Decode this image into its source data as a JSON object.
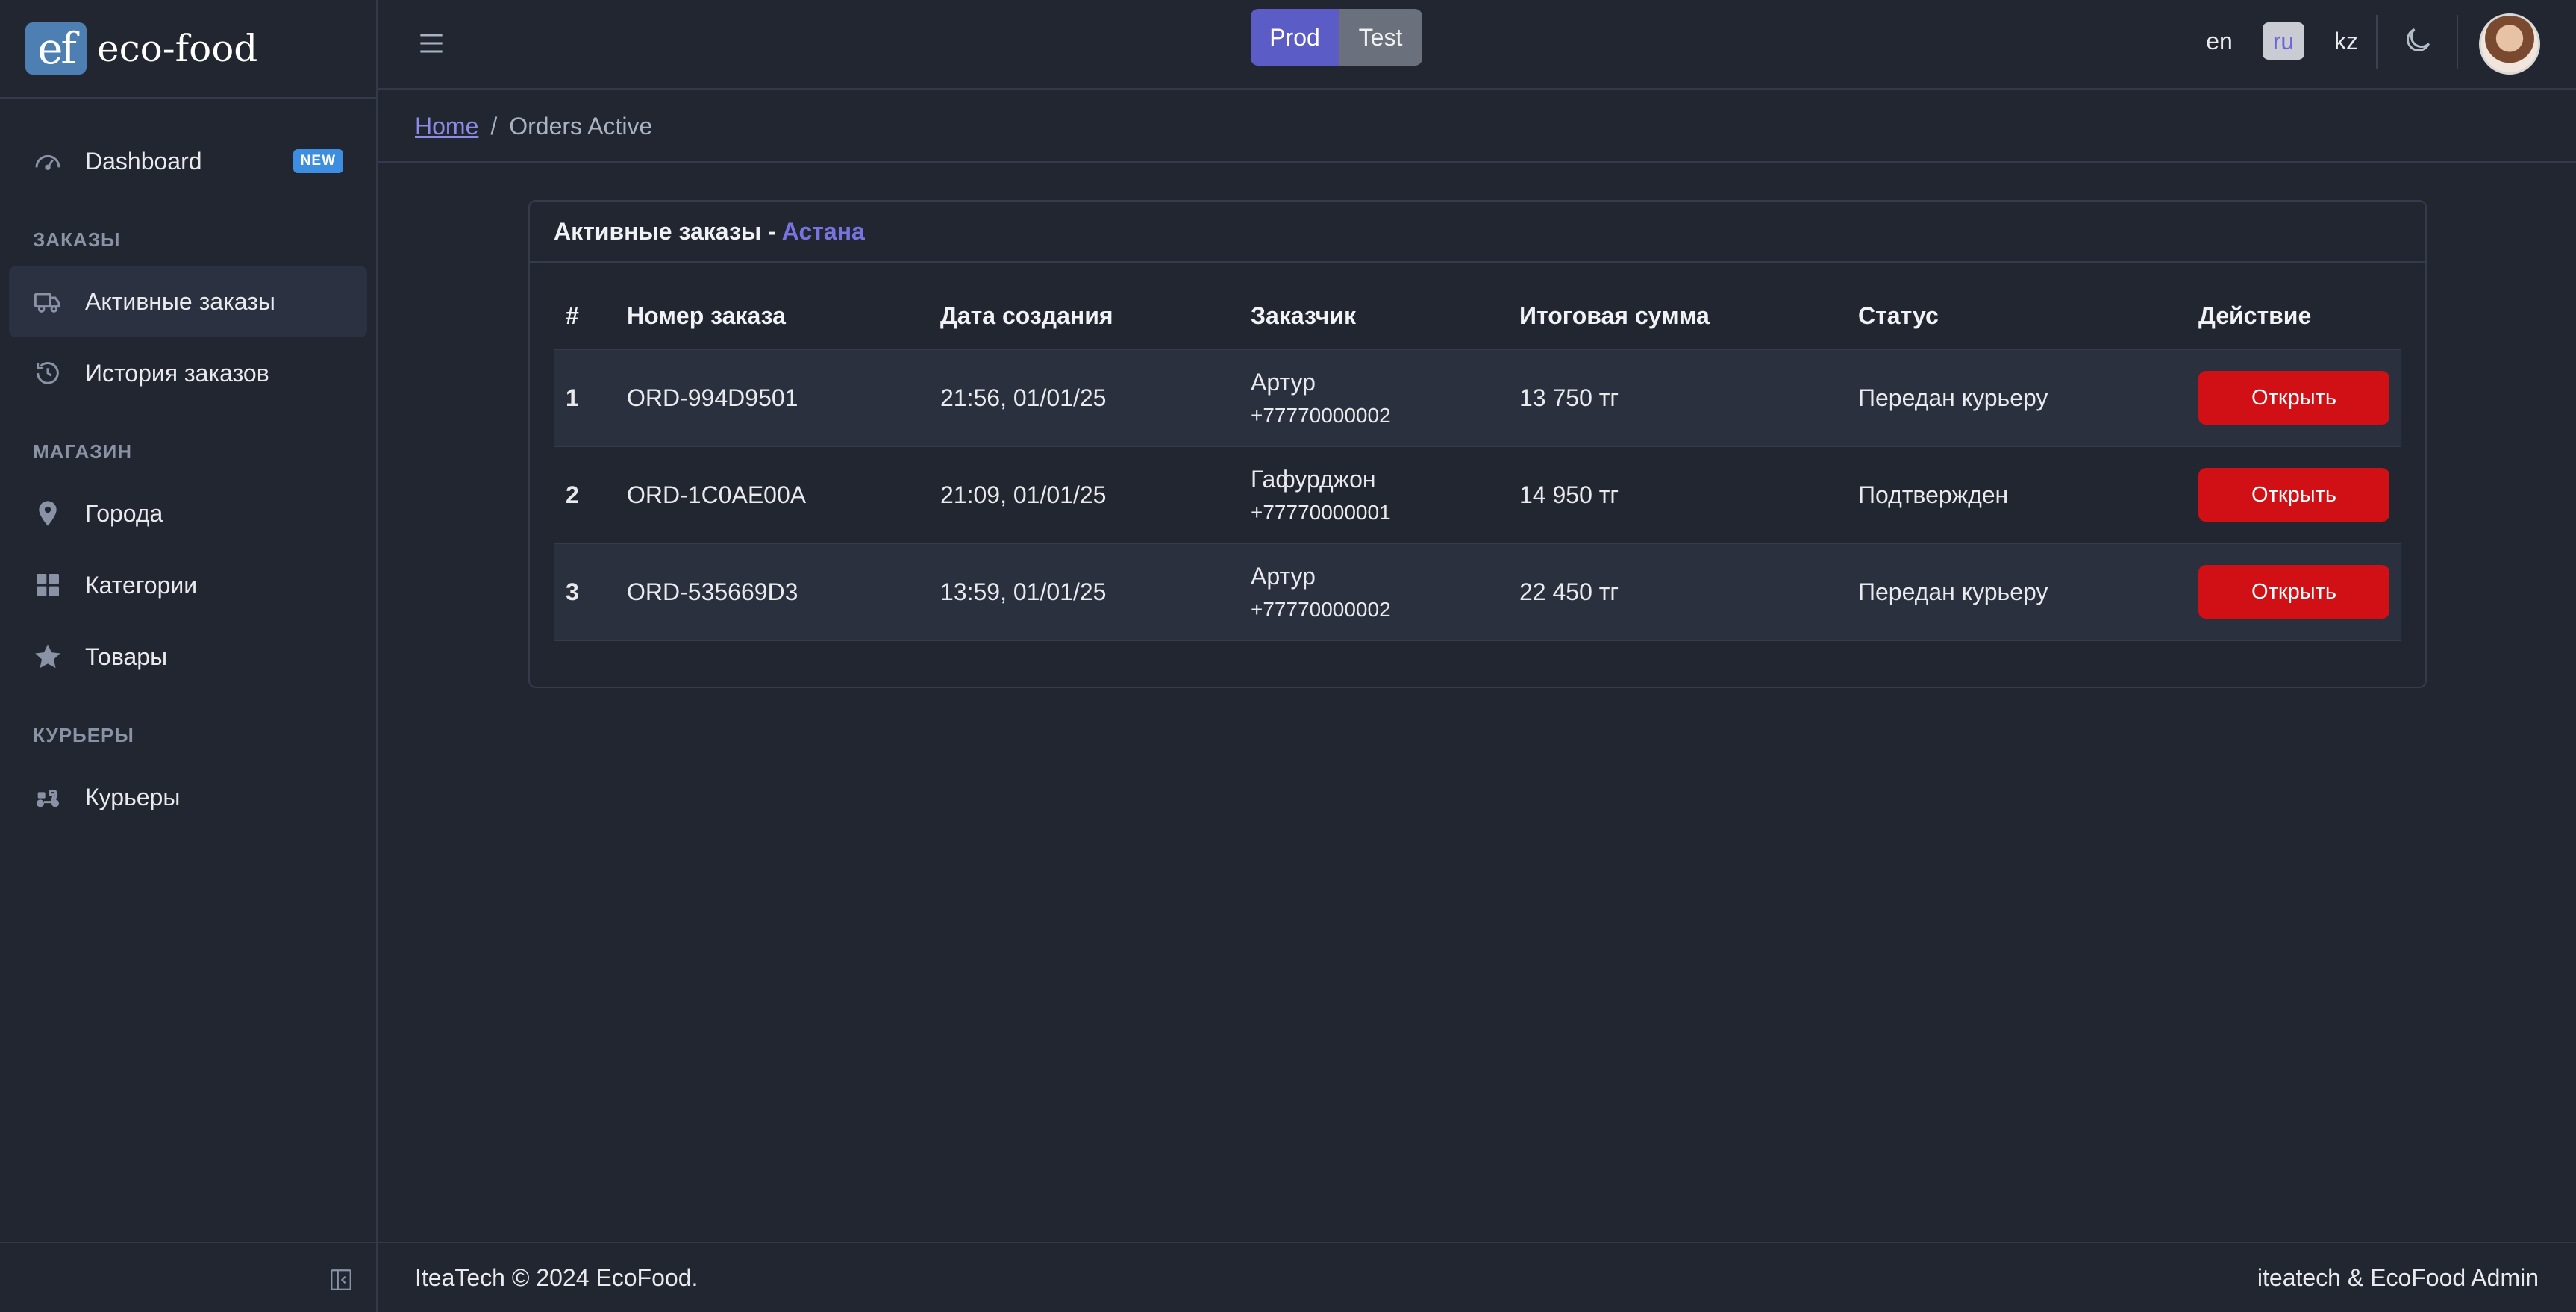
{
  "brand": {
    "logo_text": "ef",
    "name": "eco-food"
  },
  "sidebar": {
    "dashboard": {
      "label": "Dashboard",
      "badge": "NEW",
      "icon": "speedometer-icon"
    },
    "section_orders": "ЗАКАЗЫ",
    "active_orders": {
      "label": "Активные заказы",
      "icon": "truck-icon"
    },
    "order_history": {
      "label": "История заказов",
      "icon": "history-icon"
    },
    "section_shop": "МАГАЗИН",
    "cities": {
      "label": "Города",
      "icon": "location-pin-icon"
    },
    "categories": {
      "label": "Категории",
      "icon": "grid-icon"
    },
    "products": {
      "label": "Товары",
      "icon": "star-icon"
    },
    "section_couriers": "КУРЬЕРЫ",
    "couriers": {
      "label": "Курьеры",
      "icon": "scooter-icon"
    }
  },
  "header": {
    "env": {
      "prod": "Prod",
      "test": "Test",
      "selected": "Prod"
    },
    "languages": [
      "en",
      "ru",
      "kz"
    ],
    "selected_language": "ru"
  },
  "breadcrumb": {
    "home": "Home",
    "separator": "/",
    "current": "Orders Active"
  },
  "card": {
    "title": "Активные заказы - ",
    "city": "Астана"
  },
  "table": {
    "columns": [
      "#",
      "Номер заказа",
      "Дата создания",
      "Заказчик",
      "Итоговая сумма",
      "Статус",
      "Действие"
    ],
    "rows": [
      {
        "idx": "1",
        "order": "ORD-994D9501",
        "date": "21:56, 01/01/25",
        "customer": "Артур",
        "phone": "+77770000002",
        "total": "13 750 тг",
        "status": "Передан курьеру",
        "action": "Открыть"
      },
      {
        "idx": "2",
        "order": "ORD-1C0AE00A",
        "date": "21:09, 01/01/25",
        "customer": "Гафурджон",
        "phone": "+77770000001",
        "total": "14 950 тг",
        "status": "Подтвержден",
        "action": "Открыть"
      },
      {
        "idx": "3",
        "order": "ORD-535669D3",
        "date": "13:59, 01/01/25",
        "customer": "Артур",
        "phone": "+77770000002",
        "total": "22 450 тг",
        "status": "Передан курьеру",
        "action": "Открыть"
      }
    ]
  },
  "colors": {
    "background": "#212631",
    "accent": "#5b5cc6",
    "status_courier": "#3b9be8",
    "status_confirmed": "#45a84e",
    "action_button": "#d01014"
  },
  "footer": {
    "left": "IteaTech © 2024 EcoFood.",
    "right": "iteatech & EcoFood Admin"
  }
}
